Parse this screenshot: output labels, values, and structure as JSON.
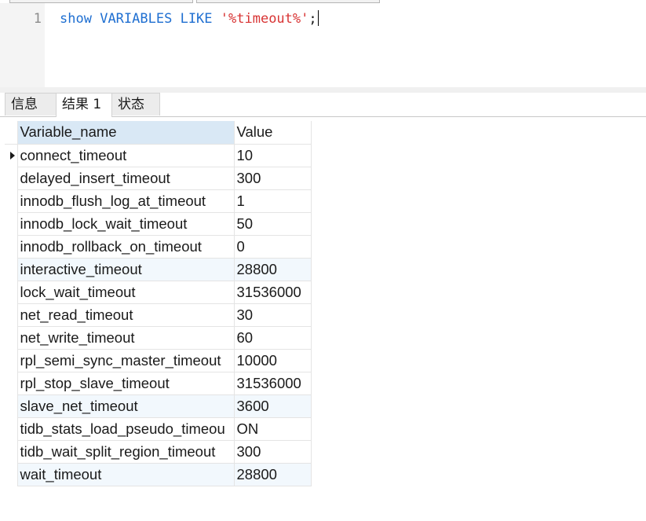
{
  "editor": {
    "line_number": "1",
    "code": {
      "keyword_show": "show",
      "keyword_variables": "VARIABLES",
      "keyword_like": "LIKE",
      "pattern": "'%timeout%'",
      "terminator": ";"
    }
  },
  "tabs": [
    {
      "label": "信息",
      "active": false
    },
    {
      "label": "结果 1",
      "active": true
    },
    {
      "label": "状态",
      "active": false
    }
  ],
  "grid": {
    "columns": [
      "Variable_name",
      "Value"
    ],
    "current_row_index": 0,
    "rows": [
      {
        "name": "connect_timeout",
        "value": "10",
        "highlight": false
      },
      {
        "name": "delayed_insert_timeout",
        "value": "300",
        "highlight": false
      },
      {
        "name": "innodb_flush_log_at_timeout",
        "value": "1",
        "highlight": false
      },
      {
        "name": "innodb_lock_wait_timeout",
        "value": "50",
        "highlight": false
      },
      {
        "name": "innodb_rollback_on_timeout",
        "value": "0",
        "highlight": false
      },
      {
        "name": "interactive_timeout",
        "value": "28800",
        "highlight": true
      },
      {
        "name": "lock_wait_timeout",
        "value": "31536000",
        "highlight": false
      },
      {
        "name": "net_read_timeout",
        "value": "30",
        "highlight": false
      },
      {
        "name": "net_write_timeout",
        "value": "60",
        "highlight": false
      },
      {
        "name": "rpl_semi_sync_master_timeout",
        "value": "10000",
        "highlight": false
      },
      {
        "name": "rpl_stop_slave_timeout",
        "value": "31536000",
        "highlight": false
      },
      {
        "name": "slave_net_timeout",
        "value": "3600",
        "highlight": true
      },
      {
        "name": "tidb_stats_load_pseudo_timeou",
        "value": "ON",
        "highlight": false
      },
      {
        "name": "tidb_wait_split_region_timeout",
        "value": "300",
        "highlight": false
      },
      {
        "name": "wait_timeout",
        "value": "28800",
        "highlight": true
      }
    ]
  },
  "colors": {
    "keyword": "#1f6fd1",
    "string": "#d83434",
    "header_selected": "#d9e8f5",
    "row_highlight": "#f2f8fd"
  },
  "icons": {
    "row_indicator": "current-row-arrow-icon"
  }
}
